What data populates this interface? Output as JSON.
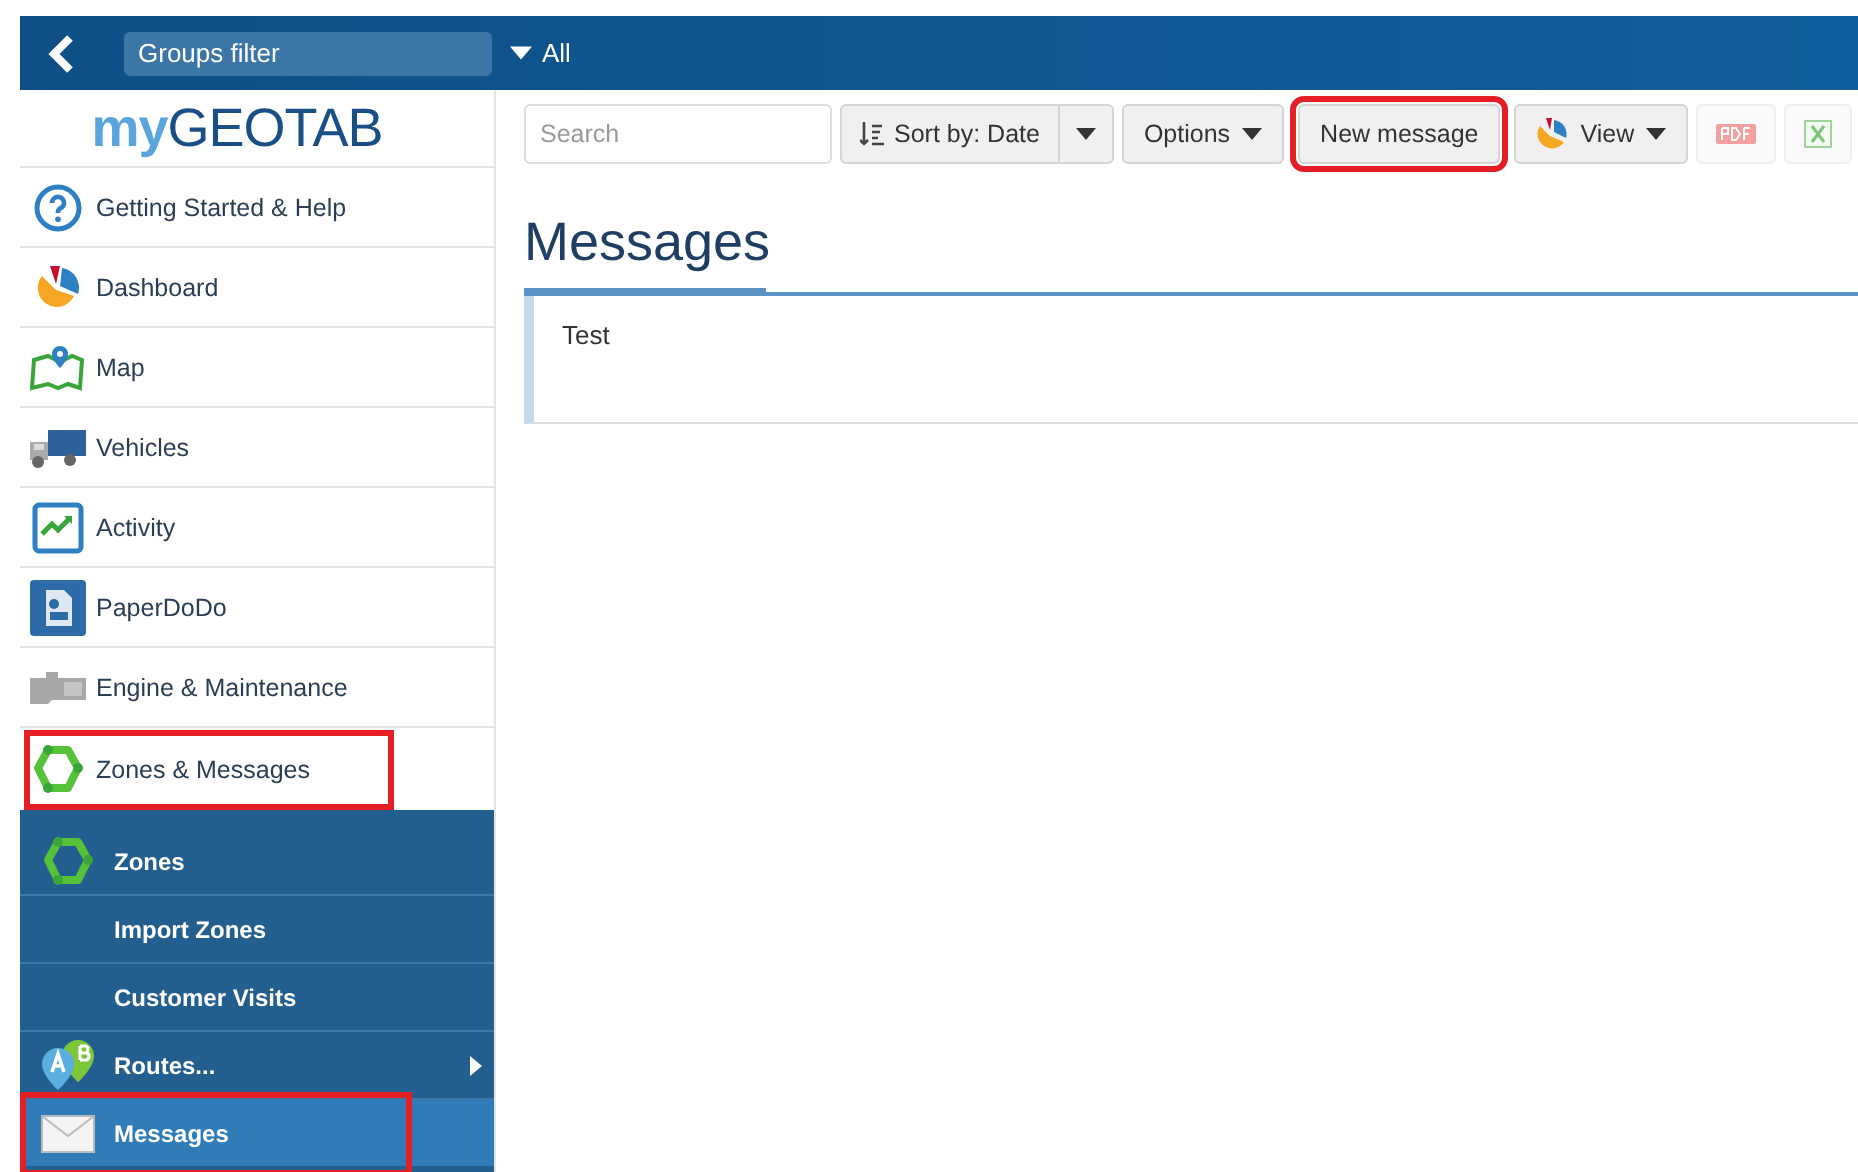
{
  "top_bar": {
    "groups_filter": {
      "placeholder": "Groups filter"
    },
    "filter_value": "All"
  },
  "logo": {
    "prefix": "my",
    "name": "GEOTAB"
  },
  "sidebar": {
    "items": [
      {
        "label": "Getting Started & Help",
        "selected": false,
        "highlighted": false
      },
      {
        "label": "Dashboard",
        "selected": false,
        "highlighted": false
      },
      {
        "label": "Map",
        "selected": false,
        "highlighted": false
      },
      {
        "label": "Vehicles",
        "selected": false,
        "highlighted": false
      },
      {
        "label": "Activity",
        "selected": false,
        "highlighted": false
      },
      {
        "label": "PaperDoDo",
        "selected": false,
        "highlighted": false
      },
      {
        "label": "Engine & Maintenance",
        "selected": false,
        "highlighted": false
      },
      {
        "label": "Zones & Messages",
        "selected": true,
        "highlighted": true
      }
    ],
    "submenu": [
      {
        "label": "Zones",
        "selected": false,
        "highlighted": false,
        "submenu_arrow": false
      },
      {
        "label": "Import Zones",
        "selected": false,
        "highlighted": false,
        "submenu_arrow": false
      },
      {
        "label": "Customer Visits",
        "selected": false,
        "highlighted": false,
        "submenu_arrow": false
      },
      {
        "label": "Routes...",
        "selected": false,
        "highlighted": false,
        "submenu_arrow": true
      },
      {
        "label": "Messages",
        "selected": true,
        "highlighted": true,
        "submenu_arrow": false
      }
    ]
  },
  "toolbar": {
    "search": {
      "placeholder": "Search"
    },
    "sort": "Sort by: Date",
    "options": "Options",
    "new_message": {
      "label": "New message",
      "highlighted": true
    },
    "view": "View"
  },
  "page": {
    "title": "Messages",
    "messages": [
      {
        "text": "Test"
      }
    ]
  }
}
